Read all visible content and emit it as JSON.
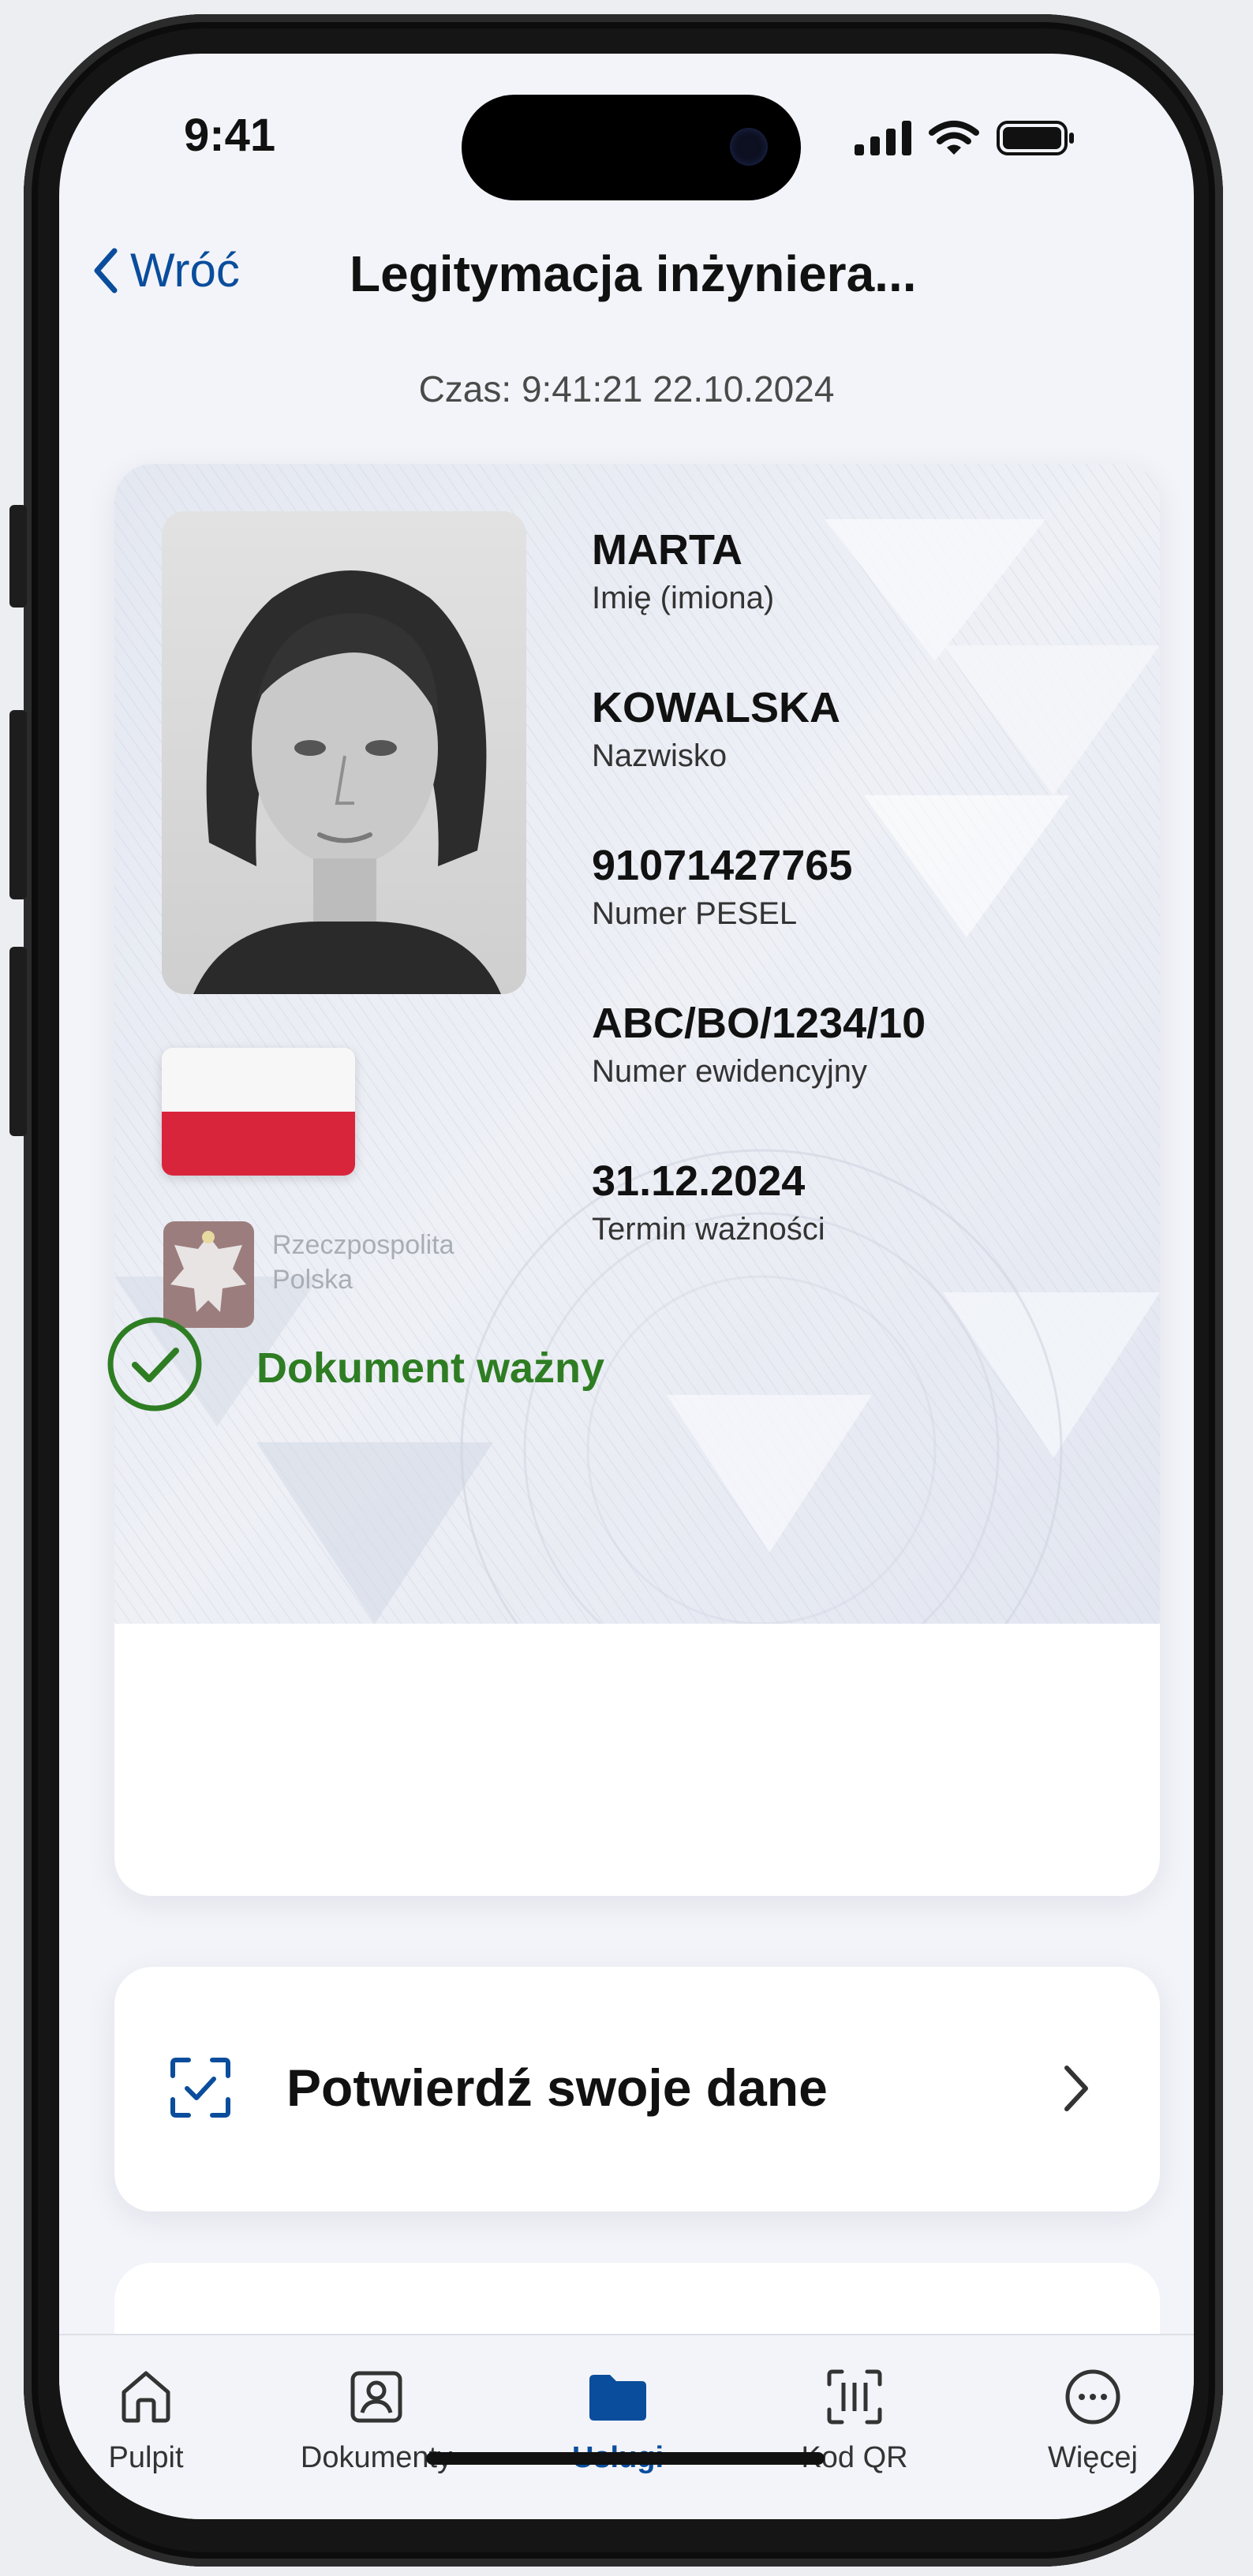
{
  "status_bar": {
    "time": "9:41"
  },
  "header": {
    "back_label": "Wróć",
    "title": "Legitymacja inżyniera..."
  },
  "timestamp": "Czas: 9:41:21 22.10.2024",
  "card": {
    "emblem_text": [
      "Rzeczpospolita",
      "Polska"
    ],
    "fields": [
      {
        "value": "MARTA",
        "label": "Imię (imiona)"
      },
      {
        "value": "KOWALSKA",
        "label": "Nazwisko"
      },
      {
        "value": "91071427765",
        "label": "Numer PESEL"
      },
      {
        "value": "ABC/BO/1234/10",
        "label": "Numer ewidencyjny"
      },
      {
        "value": "31.12.2024",
        "label": "Termin ważności"
      }
    ],
    "status": "Dokument ważny"
  },
  "actions": {
    "confirm_label": "Potwierdź swoje dane"
  },
  "tabs": [
    {
      "label": "Pulpit",
      "icon": "home-icon"
    },
    {
      "label": "Dokumenty",
      "icon": "id-card-icon"
    },
    {
      "label": "Usługi",
      "icon": "folder-icon",
      "active": true
    },
    {
      "label": "Kod QR",
      "icon": "qr-scan-icon"
    },
    {
      "label": "Więcej",
      "icon": "more-icon"
    }
  ],
  "colors": {
    "accent": "#0a4d9c",
    "valid_green": "#2e7d23",
    "flag_red": "#d8253c"
  }
}
